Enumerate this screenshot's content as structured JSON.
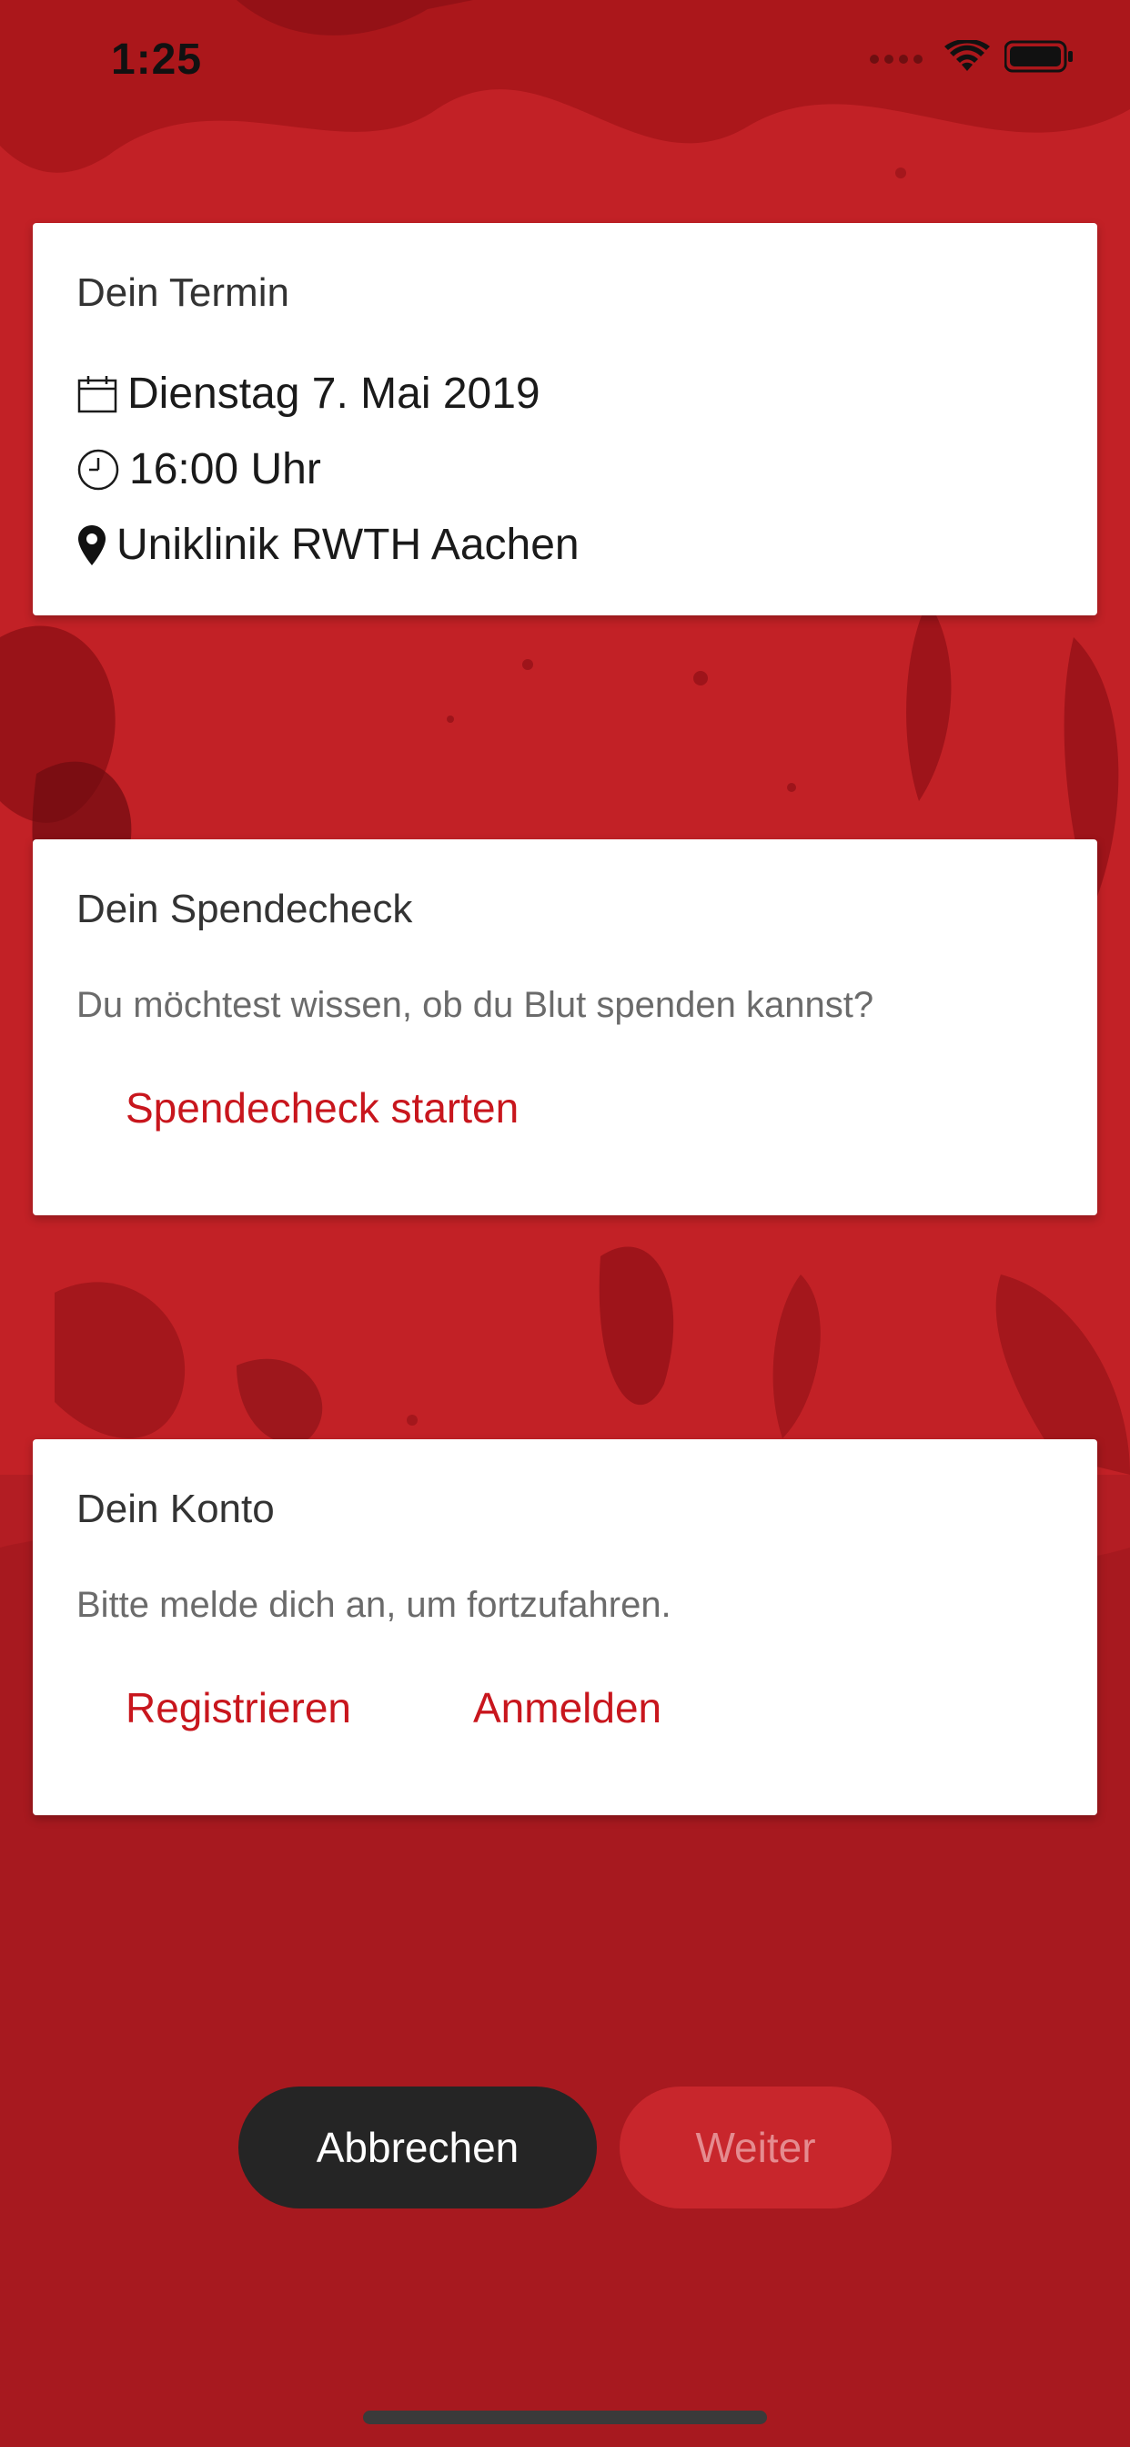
{
  "status_bar": {
    "time": "1:25"
  },
  "appointment": {
    "title": "Dein Termin",
    "date": "Dienstag 7. Mai 2019",
    "time": "16:00 Uhr",
    "location": "Uniklinik RWTH Aachen",
    "icons": [
      "calendar-icon",
      "clock-icon",
      "location-pin-icon"
    ]
  },
  "donation_check": {
    "title": "Dein Spendecheck",
    "description": "Du möchtest wissen, ob du Blut spenden kannst?",
    "start_label": "Spendecheck starten"
  },
  "account": {
    "title": "Dein Konto",
    "description": "Bitte melde dich an, um fortzufahren.",
    "register_label": "Registrieren",
    "login_label": "Anmelden"
  },
  "actions": {
    "cancel_label": "Abbrechen",
    "next_label": "Weiter",
    "next_enabled": false
  },
  "colors": {
    "background": "#c22126",
    "accent": "#c8161d",
    "card": "#ffffff",
    "cancel_button": "#252525"
  }
}
